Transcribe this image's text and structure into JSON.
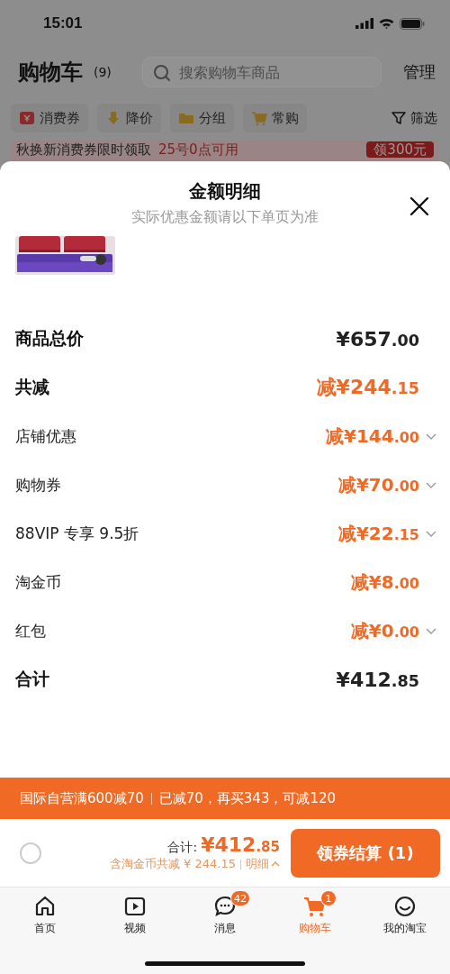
{
  "status_bar": {
    "time": "15:01"
  },
  "header": {
    "title": "购物车",
    "count": "(9)",
    "search": {
      "placeholder": "搜索购物车商品"
    },
    "manage": "管理"
  },
  "chips": [
    {
      "label": "消费券"
    },
    {
      "label": "降价"
    },
    {
      "label": "分组"
    },
    {
      "label": "常购"
    }
  ],
  "filter": "筛选",
  "banner": {
    "text": "秋换新消费券限时领取",
    "highlight": "25号0点可用",
    "button": "领300元"
  },
  "sheet": {
    "title": "金额明细",
    "subtitle": "实际优惠金额请以下单页为准",
    "rows": [
      {
        "kind": "total",
        "label": "商品总价",
        "prefix": "",
        "amount": "¥657",
        "cents": ".00",
        "expandable": false
      },
      {
        "kind": "saving",
        "label": "共减",
        "prefix": "减",
        "amount": "¥244",
        "cents": ".15",
        "expandable": false
      },
      {
        "kind": "item",
        "label": "店铺优惠",
        "prefix": "减",
        "amount": "¥144",
        "cents": ".00",
        "expandable": true
      },
      {
        "kind": "item",
        "label": "购物券",
        "prefix": "减",
        "amount": "¥70",
        "cents": ".00",
        "expandable": true
      },
      {
        "kind": "item",
        "label": "88VIP 专享 9.5折",
        "prefix": "减",
        "amount": "¥22",
        "cents": ".15",
        "expandable": true
      },
      {
        "kind": "item",
        "label": "淘金币",
        "prefix": "减",
        "amount": "¥8",
        "cents": ".00",
        "expandable": false
      },
      {
        "kind": "item",
        "label": "红包",
        "prefix": "减",
        "amount": "¥0",
        "cents": ".00",
        "expandable": true
      },
      {
        "kind": "total",
        "label": "合计",
        "prefix": "",
        "amount": "¥412",
        "cents": ".85",
        "expandable": false
      }
    ]
  },
  "promo": {
    "rule": "国际自营满600减70",
    "progress": "已减70，再买343，可减120"
  },
  "checkout": {
    "select_all": {
      "checked": false
    },
    "total_label": "合计:",
    "total_amount": "¥412",
    "total_cents": ".85",
    "savings": "含淘金币共减 ¥ 244.15",
    "detail": "明细",
    "button": "领券结算 (1)"
  },
  "tabs": [
    {
      "label": "首页",
      "selected": false
    },
    {
      "label": "视频",
      "selected": false
    },
    {
      "label": "消息",
      "selected": false,
      "badge": "42"
    },
    {
      "label": "购物车",
      "selected": true,
      "badge": "1"
    },
    {
      "label": "我的淘宝",
      "selected": false
    }
  ]
}
